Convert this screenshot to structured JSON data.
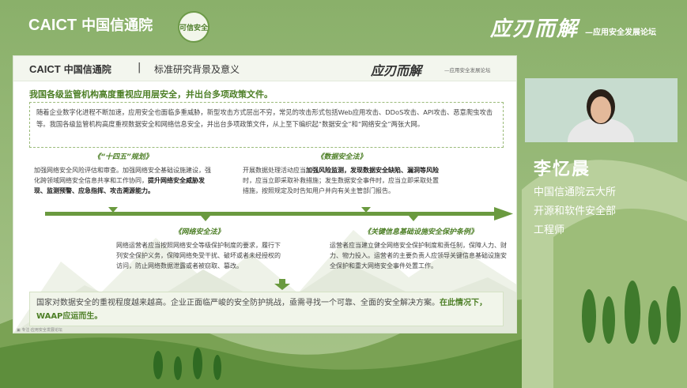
{
  "branding": {
    "caict": "CAICT",
    "caict_cn": "中国信通院",
    "badge": "可信安全",
    "slogan": "应刃而解",
    "slogan_sub": "—应用安全发展论坛"
  },
  "slide": {
    "header": {
      "logo": "CAICT",
      "logo_cn": "中国信通院",
      "divider": "|",
      "title": "标准研究背景及意义",
      "slogan": "应刃而解",
      "slogan_sub": "—应用安全发展论坛"
    },
    "headline": "我国各级监管机构高度重视应用层安全，并出台多项政策文件。",
    "intro": "随着企业数字化进程不断加速，应用安全也面临多重威胁，新型攻击方式层出不穷，常见的攻击形式包括Web应用攻击、DDoS攻击、API攻击、恶意爬虫攻击等。我国各级监管机构高度重视数据安全和网络信息安全，并出台多项政策文件，从上至下编织起“数据安全”和“网络安全”两张大网。",
    "laws": [
      {
        "title": "《“十四五”规划》",
        "text_a": "加强网络安全风险评估和审查。加强网络安全基础设施建设，强化跨领域网络安全信息共享和工作协同，",
        "text_b": "提升网络安全威胁发现、监测预警、应急指挥、攻击溯源能力。"
      },
      {
        "title": "《数据安全法》",
        "text_a": "开展数据处理活动应当",
        "text_b": "加强风险监测，发现数据安全缺陷、漏洞等风险",
        "text_c": "时，应当立即采取补救措施；发生数据安全事件时，应当立即采取处置措施，按照规定及时告知用户并向有关主管部门报告。"
      },
      {
        "title": "《网络安全法》",
        "text_a": "网络运营者应当按照网络安全等级保护制度的要求，履行下列安全保护义务，保障网络免受干扰、破坏或者未经授权的访问，防止网络数据泄露或者被窃取、篡改。"
      },
      {
        "title": "《关键信息基础设施安全保护条例》",
        "text_a": "运营者应当建立健全网络安全保护制度和责任制，保障人力、财力、物力投入。运营者的主要负责人应领导关键信息基础设施安全保护和重大网络安全事件处置工作。"
      }
    ],
    "conclusion_a": "国家对数据安全的重视程度越来越高。企业正面临严峻的安全防护挑战，亟需寻找一个可靠、全面的安全解决方案。",
    "conclusion_b": "在此情况下，WAAP应运而生。",
    "footer": "▣ 专注·应用安全发展论坛"
  },
  "speaker": {
    "name": "李忆晨",
    "org": "中国信通院云大所",
    "dept": "开源和软件安全部",
    "title": "工程师"
  },
  "colors": {
    "background": "#8fb06f",
    "accent_green": "#4d7f26",
    "timeline_green": "#6a9a3f"
  }
}
